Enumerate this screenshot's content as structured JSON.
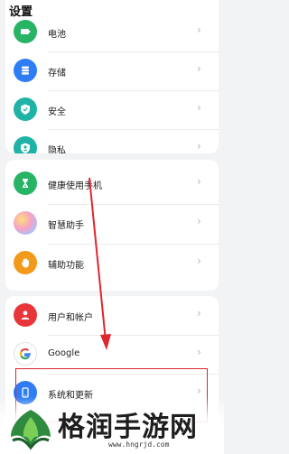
{
  "header": {
    "title": "设置"
  },
  "settings": {
    "chevron": "›",
    "items": [
      {
        "label": "电池",
        "icon": "battery-icon",
        "color": "#27b565"
      },
      {
        "label": "存储",
        "icon": "storage-icon",
        "color": "#2f7df6"
      },
      {
        "label": "安全",
        "icon": "shield-icon",
        "color": "#1fb3a6"
      },
      {
        "label": "隐私",
        "icon": "privacy-icon",
        "color": "#1fb3a6"
      },
      {
        "label": "健康使用手机",
        "icon": "hourglass-icon",
        "color": "#27b565"
      },
      {
        "label": "智慧助手",
        "icon": "assistant-icon",
        "color": "#c884e8"
      },
      {
        "label": "辅助功能",
        "icon": "hand-icon",
        "color": "#f39a1b"
      },
      {
        "label": "用户和帐户",
        "icon": "user-icon",
        "color": "#e8353a"
      },
      {
        "label": "Google",
        "icon": "google-icon",
        "color": "#ffffff"
      },
      {
        "label": "系统和更新",
        "icon": "system-update-icon",
        "color": "#2f7df6"
      }
    ]
  },
  "watermark": {
    "text": "格润手游网",
    "url": "www.hngrjd.com"
  },
  "annotation": {
    "color": "#e0262f"
  }
}
